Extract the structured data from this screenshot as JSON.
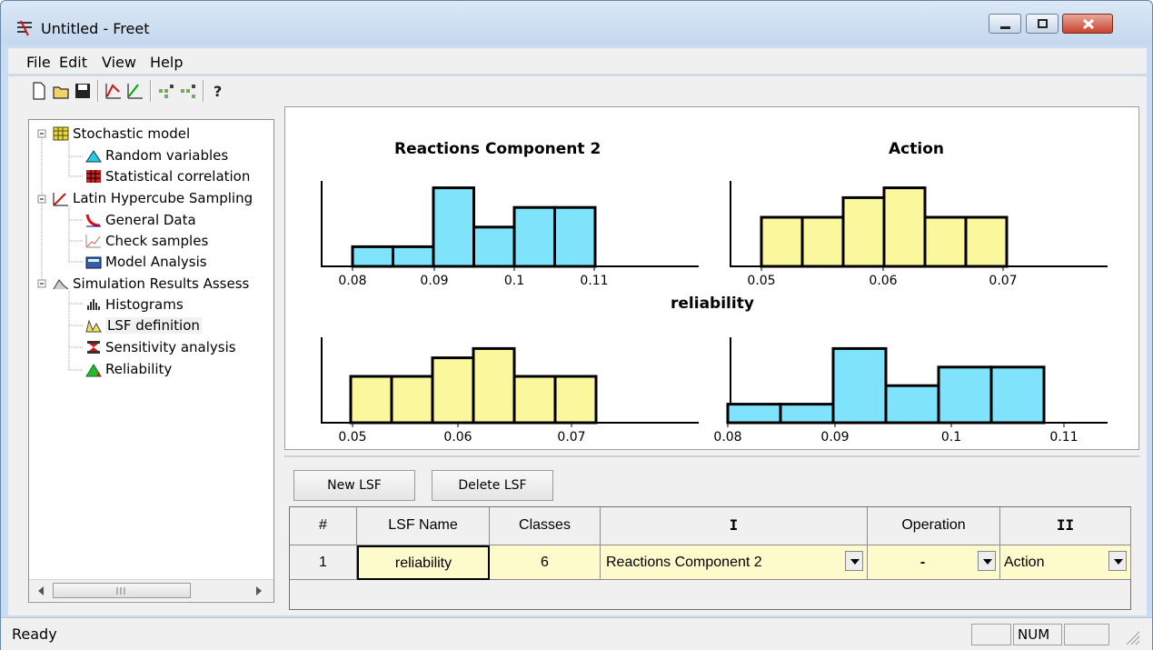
{
  "window": {
    "title": "Untitled - Freet"
  },
  "menu": [
    "File",
    "Edit",
    "View",
    "Help"
  ],
  "toolbar_icons": [
    "new-icon",
    "open-icon",
    "save-icon",
    "lhs-icon-1",
    "lhs-icon-2",
    "grid-icon-1",
    "grid-icon-2",
    "help-icon"
  ],
  "tree": {
    "items": [
      {
        "label": "Stochastic model",
        "icon": "grid-icon"
      },
      {
        "label": "Random variables",
        "icon": "triangle-icon"
      },
      {
        "label": "Statistical correlation",
        "icon": "correlation-icon"
      },
      {
        "label": "Latin Hypercube Sampling",
        "icon": "lhs-icon"
      },
      {
        "label": "General Data",
        "icon": "curve-icon"
      },
      {
        "label": "Check samples",
        "icon": "check-icon"
      },
      {
        "label": "Model Analysis",
        "icon": "calculator-icon"
      },
      {
        "label": "Simulation Results Assess",
        "icon": "results-icon"
      },
      {
        "label": "Histograms",
        "icon": "histogram-icon"
      },
      {
        "label": "LSF definition",
        "icon": "lsf-icon"
      },
      {
        "label": "Sensitivity analysis",
        "icon": "sensitivity-icon"
      },
      {
        "label": "Reliability",
        "icon": "reliability-icon"
      }
    ]
  },
  "chart_data": [
    {
      "type": "bar",
      "title": "Reactions Component 2",
      "categories": [
        "0.080",
        "0.085",
        "0.090",
        "0.095",
        "0.100",
        "0.105"
      ],
      "values": [
        2,
        2,
        8,
        4,
        6,
        6
      ],
      "xticks": [
        "0.08",
        "0.09",
        "0.1",
        "0.11"
      ],
      "color": "#7fe3fb"
    },
    {
      "type": "bar",
      "title": "Action",
      "categories": [
        "0.049",
        "0.053",
        "0.057",
        "0.061",
        "0.064",
        "0.068"
      ],
      "values": [
        5,
        5,
        7,
        8,
        5,
        5
      ],
      "xticks": [
        "0.05",
        "0.06",
        "0.07"
      ],
      "color": "#fbf79c"
    },
    {
      "type": "bar",
      "title": "reliability",
      "categories": [
        "0.049",
        "0.053",
        "0.057",
        "0.061",
        "0.064",
        "0.068"
      ],
      "values": [
        5,
        5,
        7,
        8,
        5,
        5
      ],
      "xticks": [
        "0.05",
        "0.06",
        "0.07"
      ],
      "color": "#fbf79c"
    },
    {
      "type": "bar",
      "title": "",
      "categories": [
        "0.080",
        "0.085",
        "0.090",
        "0.095",
        "0.100",
        "0.105"
      ],
      "values": [
        2,
        2,
        8,
        4,
        6,
        6
      ],
      "xticks": [
        "0.08",
        "0.09",
        "0.1",
        "0.11"
      ],
      "color": "#7fe3fb"
    }
  ],
  "lsf": {
    "new_btn": "New LSF",
    "delete_btn": "Delete LSF",
    "columns": [
      "#",
      "LSF Name",
      "Classes",
      "I",
      "Operation",
      "II"
    ],
    "row": {
      "num": "1",
      "name": "reliability",
      "classes": "6",
      "i": "Reactions Component 2",
      "op": "-",
      "ii": "Action"
    }
  },
  "status": {
    "text": "Ready",
    "num": "NUM"
  }
}
